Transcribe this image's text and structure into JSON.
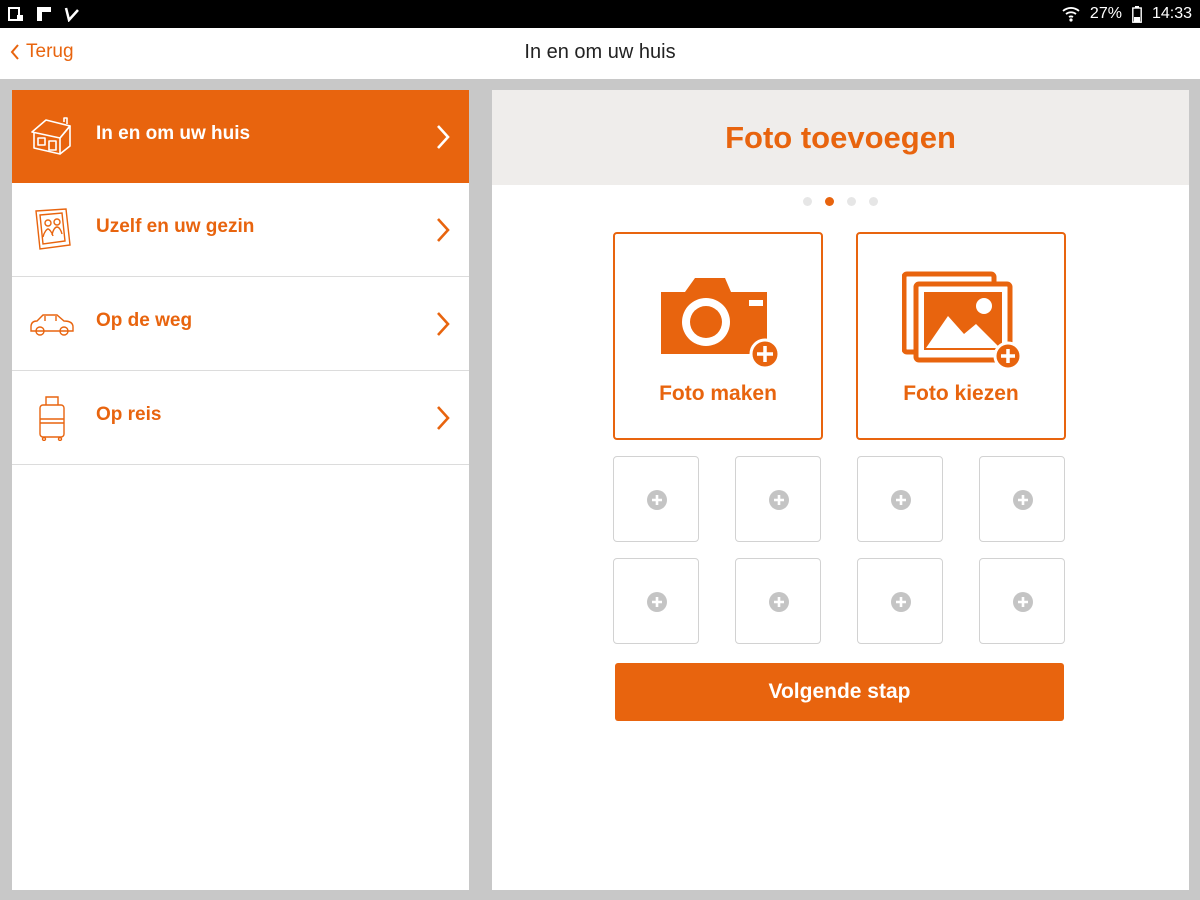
{
  "status_bar": {
    "battery": "27%",
    "time": "14:33",
    "icons": [
      "screenshot-icon",
      "flipboard-icon",
      "checkmark-notification-icon",
      "wifi-icon",
      "battery-icon"
    ]
  },
  "app_bar": {
    "back_label": "Terug",
    "title": "In en om uw huis"
  },
  "sidebar": {
    "items": [
      {
        "label": "In en om uw huis",
        "icon": "house-icon",
        "active": true
      },
      {
        "label": "Uzelf en uw gezin",
        "icon": "family-frame-icon",
        "active": false
      },
      {
        "label": "Op de weg",
        "icon": "car-icon",
        "active": false
      },
      {
        "label": "Op reis",
        "icon": "suitcase-icon",
        "active": false
      }
    ]
  },
  "main": {
    "title": "Foto toevoegen",
    "pager": {
      "total": 4,
      "current": 2
    },
    "take_photo_label": "Foto maken",
    "choose_photo_label": "Foto kiezen",
    "photo_slots": 8,
    "next_label": "Volgende stap"
  },
  "colors": {
    "accent": "#e8640e",
    "header_bg": "#efedeb",
    "page_bg": "#c8c8c8"
  }
}
